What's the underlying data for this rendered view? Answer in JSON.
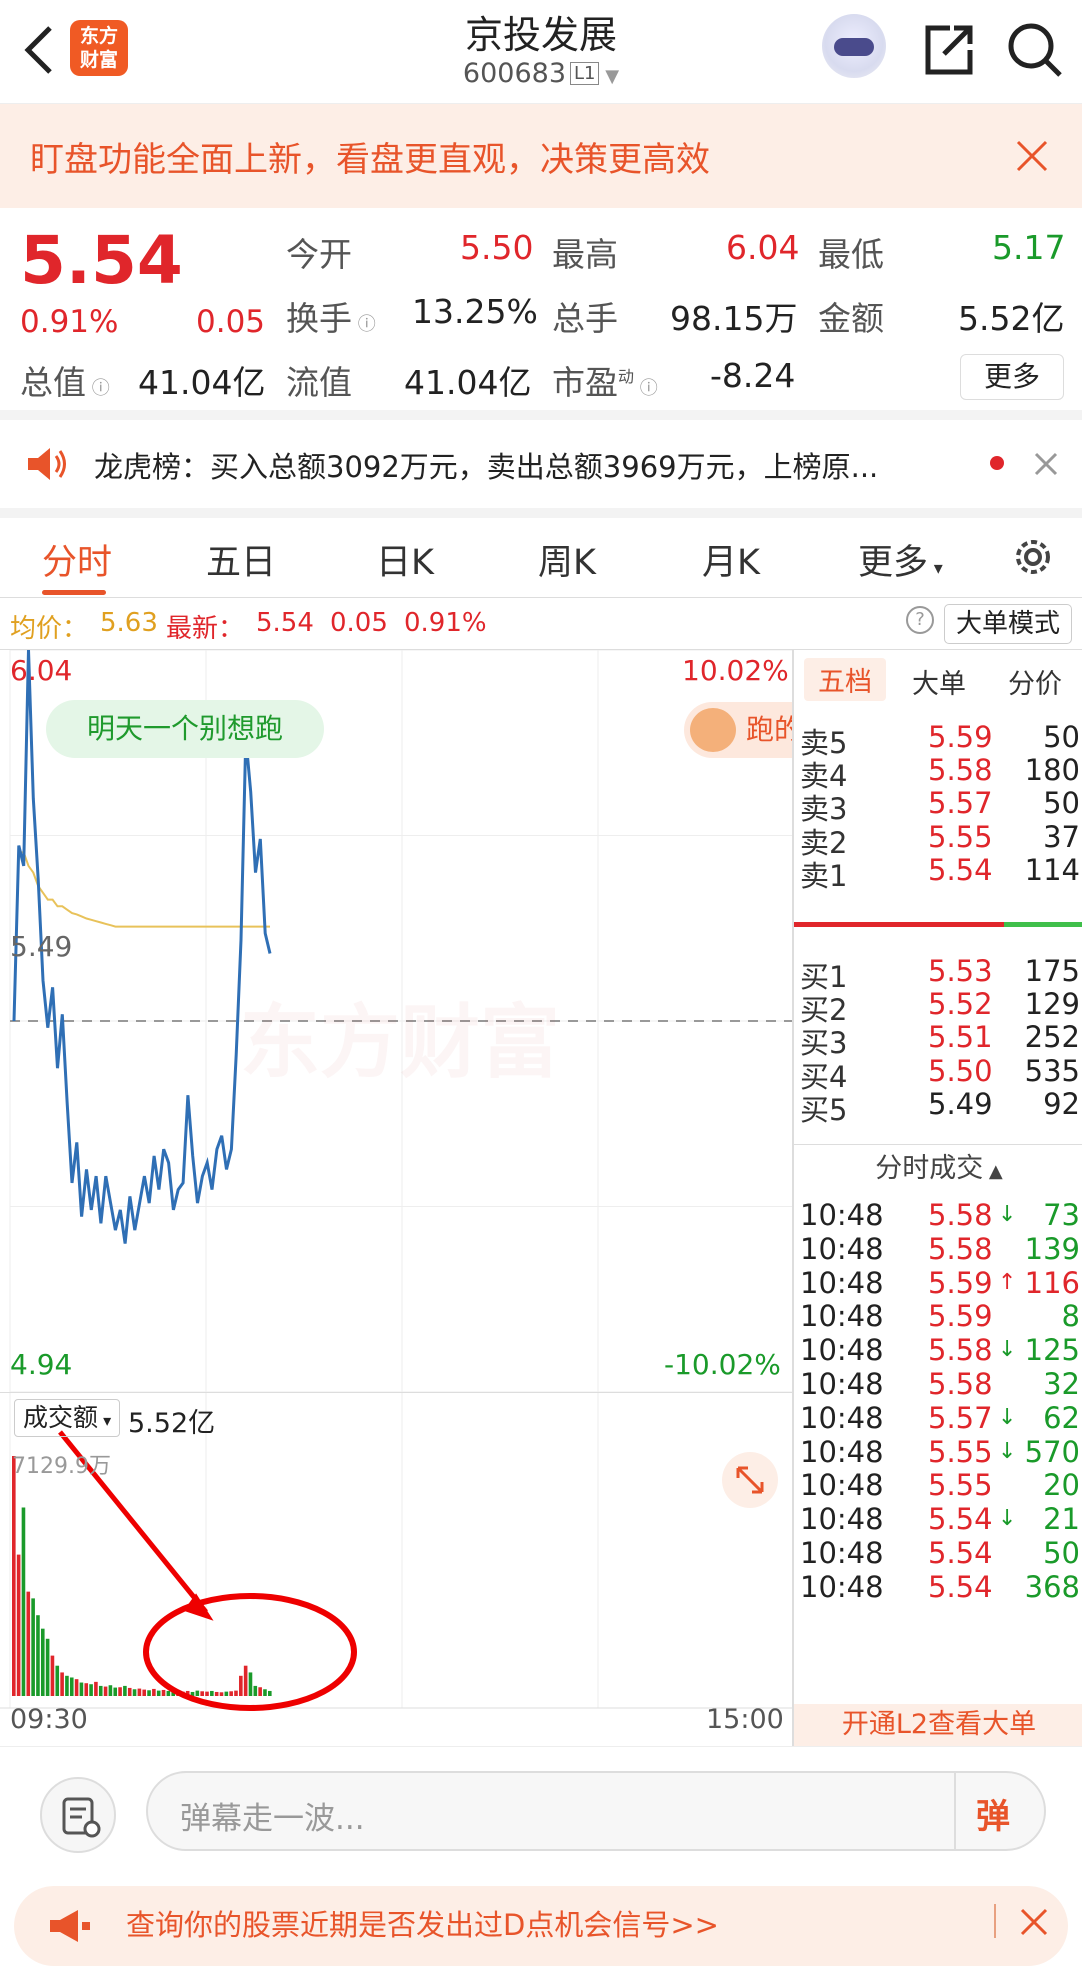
{
  "header": {
    "back_icon": "chevron-left-icon",
    "logo_line1": "东方",
    "logo_line2": "财富",
    "title": "京投发展",
    "code": "600683",
    "level": "L1"
  },
  "notice": {
    "text": "盯盘功能全面上新，看盘更直观，决策更高效"
  },
  "quote": {
    "price": "5.54",
    "change_pct": "0.91%",
    "change": "0.05",
    "open_label": "今开",
    "open": "5.50",
    "high_label": "最高",
    "high": "6.04",
    "low_label": "最低",
    "low": "5.17",
    "turnover_label": "换手",
    "turnover": "13.25%",
    "vol_label": "总手",
    "vol": "98.15万",
    "amount_label": "金额",
    "amount": "5.52亿",
    "mktcap_label": "总值",
    "mktcap": "41.04亿",
    "float_label": "流值",
    "float": "41.04亿",
    "pe_label": "市盈",
    "pe_sup": "动",
    "pe": "-8.24",
    "more": "更多"
  },
  "lhb": {
    "text": "龙虎榜：买入总额3092万元，卖出总额3969万元，上榜原..."
  },
  "tabs": [
    "分时",
    "五日",
    "日K",
    "周K",
    "月K",
    "更多"
  ],
  "avg_row": {
    "avg_label": "均价：",
    "avg": "5.63",
    "last_label": "最新：",
    "last": "5.54",
    "chg": "0.05",
    "pct": "0.91%",
    "mode": "大单模式"
  },
  "chart_labels": {
    "top_price": "6.04",
    "top_pct": "10.02%",
    "mid_price": "5.49",
    "bot_price": "4.94",
    "bot_pct": "-10.02%",
    "bubble": "明天一个别想跑",
    "paoba": "跑的",
    "watermark": "东方财富",
    "vol_selector": "成交额",
    "vol_total": "5.52亿",
    "vol_max": "7129.9万",
    "t_start": "09:30",
    "t_end": "15:00"
  },
  "chart_data": {
    "type": "line",
    "ylim": [
      4.94,
      6.04
    ],
    "x_range": [
      "09:30",
      "15:00"
    ],
    "ref_price": 5.49,
    "series": [
      {
        "values": [
          5.49,
          5.75,
          5.72,
          6.04,
          5.82,
          5.7,
          5.55,
          5.48,
          5.54,
          5.42,
          5.5,
          5.37,
          5.25,
          5.31,
          5.2,
          5.27,
          5.21,
          5.26,
          5.19,
          5.26,
          5.22,
          5.18,
          5.21,
          5.16,
          5.23,
          5.18,
          5.22,
          5.26,
          5.22,
          5.29,
          5.24,
          5.3,
          5.28,
          5.21,
          5.24,
          5.25,
          5.38,
          5.29,
          5.22,
          5.26,
          5.28,
          5.24,
          5.3,
          5.32,
          5.27,
          5.3,
          5.44,
          5.61,
          5.91,
          5.83,
          5.71,
          5.76,
          5.62,
          5.59
        ]
      },
      {
        "values": [
          5.49,
          5.74,
          5.74,
          5.72,
          5.71,
          5.69,
          5.68,
          5.67,
          5.67,
          5.66,
          5.66,
          5.655,
          5.65,
          5.648,
          5.645,
          5.642,
          5.64,
          5.638,
          5.636,
          5.634,
          5.632,
          5.63,
          5.63,
          5.63,
          5.63,
          5.63,
          5.63,
          5.63,
          5.63,
          5.63,
          5.63,
          5.63,
          5.63,
          5.63,
          5.63,
          5.63,
          5.63,
          5.63,
          5.63,
          5.63,
          5.63,
          5.63,
          5.63,
          5.63,
          5.63,
          5.63,
          5.63,
          5.63,
          5.63,
          5.63,
          5.63,
          5.63,
          5.63,
          5.63
        ]
      }
    ],
    "volume": [
      7129.9,
      4200,
      5600,
      3100,
      2900,
      2400,
      2000,
      1700,
      1200,
      900,
      700,
      600,
      550,
      500,
      400,
      380,
      350,
      420,
      300,
      280,
      320,
      250,
      260,
      300,
      240,
      200,
      220,
      190,
      170,
      210,
      160,
      180,
      150,
      140,
      170,
      130,
      150,
      120,
      160,
      140,
      130,
      150,
      120,
      110,
      130,
      140,
      160,
      600,
      900,
      700,
      300,
      260,
      200,
      150
    ]
  },
  "orderbook": {
    "tabs": [
      "五档",
      "大单",
      "分价"
    ],
    "asks": [
      {
        "l": "卖5",
        "p": "5.59",
        "v": "50"
      },
      {
        "l": "卖4",
        "p": "5.58",
        "v": "180"
      },
      {
        "l": "卖3",
        "p": "5.57",
        "v": "50"
      },
      {
        "l": "卖2",
        "p": "5.55",
        "v": "37"
      },
      {
        "l": "卖1",
        "p": "5.54",
        "v": "114"
      }
    ],
    "bids": [
      {
        "l": "买1",
        "p": "5.53",
        "v": "175"
      },
      {
        "l": "买2",
        "p": "5.52",
        "v": "129"
      },
      {
        "l": "买3",
        "p": "5.51",
        "v": "252"
      },
      {
        "l": "买4",
        "p": "5.50",
        "v": "535"
      },
      {
        "l": "买5",
        "p": "5.49",
        "v": "92"
      }
    ],
    "trades_title": "分时成交",
    "trades": [
      {
        "t": "10:48",
        "p": "5.58",
        "a": "↓",
        "v": "73"
      },
      {
        "t": "10:48",
        "p": "5.58",
        "a": "",
        "v": "139"
      },
      {
        "t": "10:48",
        "p": "5.59",
        "a": "↑",
        "v": "116"
      },
      {
        "t": "10:48",
        "p": "5.59",
        "a": "",
        "v": "8"
      },
      {
        "t": "10:48",
        "p": "5.58",
        "a": "↓",
        "v": "125"
      },
      {
        "t": "10:48",
        "p": "5.58",
        "a": "",
        "v": "32"
      },
      {
        "t": "10:48",
        "p": "5.57",
        "a": "↓",
        "v": "62"
      },
      {
        "t": "10:48",
        "p": "5.55",
        "a": "↓",
        "v": "570"
      },
      {
        "t": "10:48",
        "p": "5.55",
        "a": "",
        "v": "20"
      },
      {
        "t": "10:48",
        "p": "5.54",
        "a": "↓",
        "v": "21"
      },
      {
        "t": "10:48",
        "p": "5.54",
        "a": "",
        "v": "50"
      },
      {
        "t": "10:48",
        "p": "5.54",
        "a": "",
        "v": "368"
      }
    ],
    "l2": "开通L2查看大单"
  },
  "chat": {
    "placeholder": "弹幕走一波...",
    "send": "弹"
  },
  "banner": {
    "text": "查询你的股票近期是否发出过D点机会信号>>"
  },
  "colors": {
    "up": "#e0262b",
    "down": "#1a9a2a",
    "accent": "#e8542a",
    "price_line": "#2f6fb5",
    "avg_line": "#e8c25a"
  }
}
